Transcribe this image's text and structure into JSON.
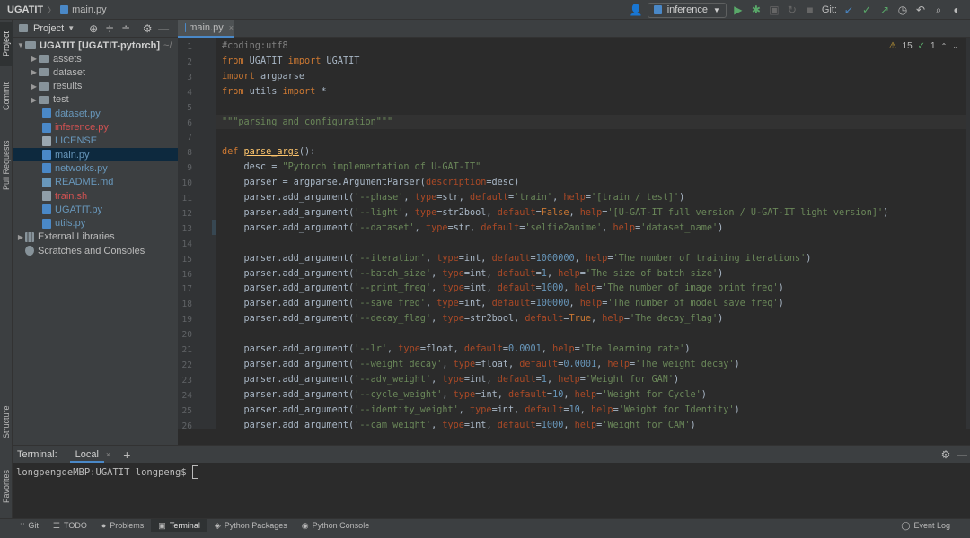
{
  "breadcrumb": {
    "project": "UGATIT",
    "file": "main.py"
  },
  "toolbar": {
    "run_config": "inference",
    "git_label": "Git:"
  },
  "left_strip": {
    "project": "Project",
    "commit": "Commit",
    "pull_requests": "Pull Requests",
    "structure": "Structure",
    "favorites": "Favorites"
  },
  "project_panel": {
    "title": "Project",
    "root": "UGATIT [UGATIT-pytorch]",
    "root_path": "~/",
    "items": [
      {
        "label": "assets",
        "kind": "folder",
        "color": "#bbbbbb"
      },
      {
        "label": "dataset",
        "kind": "folder",
        "color": "#bbbbbb"
      },
      {
        "label": "results",
        "kind": "folder",
        "color": "#bbbbbb"
      },
      {
        "label": "test",
        "kind": "folder",
        "color": "#bbbbbb"
      },
      {
        "label": "dataset.py",
        "kind": "py",
        "color": "#6897bb"
      },
      {
        "label": "inference.py",
        "kind": "py",
        "color": "#d25252"
      },
      {
        "label": "LICENSE",
        "kind": "txt",
        "color": "#6897bb"
      },
      {
        "label": "main.py",
        "kind": "py",
        "color": "#6897bb"
      },
      {
        "label": "networks.py",
        "kind": "py",
        "color": "#6897bb"
      },
      {
        "label": "README.md",
        "kind": "md",
        "color": "#6897bb"
      },
      {
        "label": "train.sh",
        "kind": "sh",
        "color": "#d25252"
      },
      {
        "label": "UGATIT.py",
        "kind": "py",
        "color": "#6897bb"
      },
      {
        "label": "utils.py",
        "kind": "py",
        "color": "#6897bb"
      },
      {
        "label": "External Libraries",
        "kind": "lib",
        "color": "#bbbbbb"
      },
      {
        "label": "Scratches and Consoles",
        "kind": "scratch",
        "color": "#bbbbbb"
      }
    ]
  },
  "editor": {
    "tab": "main.py",
    "warnings": "15",
    "checks": "1",
    "lines": [
      {
        "n": "1",
        "t": [
          [
            "cmt",
            "#coding:utf8"
          ]
        ]
      },
      {
        "n": "2",
        "t": [
          [
            "kw",
            "from "
          ],
          [
            "",
            "UGATIT "
          ],
          [
            "kw",
            "import "
          ],
          [
            "",
            "UGATIT"
          ]
        ]
      },
      {
        "n": "3",
        "t": [
          [
            "kw",
            "import "
          ],
          [
            "",
            "argparse"
          ]
        ]
      },
      {
        "n": "4",
        "t": [
          [
            "kw",
            "from "
          ],
          [
            "",
            "utils "
          ],
          [
            "kw",
            "import "
          ],
          [
            "",
            "*"
          ]
        ]
      },
      {
        "n": "5",
        "t": []
      },
      {
        "n": "6",
        "t": [
          [
            "str",
            "\"\"\"parsing and configuration\"\"\""
          ]
        ]
      },
      {
        "n": "7",
        "t": []
      },
      {
        "n": "8",
        "t": [
          [
            "kw",
            "def "
          ],
          [
            "fn",
            "parse_args"
          ],
          [
            "",
            "():"
          ]
        ]
      },
      {
        "n": "9",
        "t": [
          [
            "",
            "    desc = "
          ],
          [
            "str",
            "\"Pytorch implementation of U-GAT-IT\""
          ]
        ]
      },
      {
        "n": "10",
        "t": [
          [
            "",
            "    parser = argparse.ArgumentParser("
          ],
          [
            "prm",
            "description"
          ],
          [
            "",
            "=desc)"
          ]
        ]
      },
      {
        "n": "11",
        "t": [
          [
            "",
            "    parser.add_argument("
          ],
          [
            "str",
            "'--phase'"
          ],
          [
            "",
            ", "
          ],
          [
            "prm",
            "type"
          ],
          [
            "",
            "=str, "
          ],
          [
            "prm",
            "default"
          ],
          [
            "",
            "="
          ],
          [
            "str",
            "'train'"
          ],
          [
            "",
            ", "
          ],
          [
            "prm",
            "help"
          ],
          [
            "",
            "="
          ],
          [
            "str",
            "'[train / test]'"
          ],
          [
            "",
            ")"
          ]
        ]
      },
      {
        "n": "12",
        "t": [
          [
            "",
            "    parser.add_argument("
          ],
          [
            "str",
            "'--light'"
          ],
          [
            "",
            ", "
          ],
          [
            "prm",
            "type"
          ],
          [
            "",
            "=str2bool, "
          ],
          [
            "prm",
            "default"
          ],
          [
            "",
            "="
          ],
          [
            "kw",
            "False"
          ],
          [
            "",
            ", "
          ],
          [
            "prm",
            "help"
          ],
          [
            "",
            "="
          ],
          [
            "str",
            "'[U-GAT-IT full version / U-GAT-IT light version]'"
          ],
          [
            "",
            ")"
          ]
        ]
      },
      {
        "n": "13",
        "t": [
          [
            "",
            "    parser.add_argument("
          ],
          [
            "str",
            "'--dataset'"
          ],
          [
            "",
            ", "
          ],
          [
            "prm",
            "type"
          ],
          [
            "",
            "=str, "
          ],
          [
            "prm",
            "default"
          ],
          [
            "",
            "="
          ],
          [
            "str",
            "'selfie2anime'"
          ],
          [
            "",
            ", "
          ],
          [
            "prm",
            "help"
          ],
          [
            "",
            "="
          ],
          [
            "str",
            "'dataset_name'"
          ],
          [
            "",
            ")"
          ]
        ]
      },
      {
        "n": "14",
        "t": []
      },
      {
        "n": "15",
        "t": [
          [
            "",
            "    parser.add_argument("
          ],
          [
            "str",
            "'--iteration'"
          ],
          [
            "",
            ", "
          ],
          [
            "prm",
            "type"
          ],
          [
            "",
            "=int, "
          ],
          [
            "prm",
            "default"
          ],
          [
            "",
            "="
          ],
          [
            "num",
            "1000000"
          ],
          [
            "",
            ", "
          ],
          [
            "prm",
            "help"
          ],
          [
            "",
            "="
          ],
          [
            "str",
            "'The number of training iterations'"
          ],
          [
            "",
            ")"
          ]
        ]
      },
      {
        "n": "16",
        "t": [
          [
            "",
            "    parser.add_argument("
          ],
          [
            "str",
            "'--batch_size'"
          ],
          [
            "",
            ", "
          ],
          [
            "prm",
            "type"
          ],
          [
            "",
            "=int, "
          ],
          [
            "prm",
            "default"
          ],
          [
            "",
            "="
          ],
          [
            "num",
            "1"
          ],
          [
            "",
            ", "
          ],
          [
            "prm",
            "help"
          ],
          [
            "",
            "="
          ],
          [
            "str",
            "'The size of batch size'"
          ],
          [
            "",
            ")"
          ]
        ]
      },
      {
        "n": "17",
        "t": [
          [
            "",
            "    parser.add_argument("
          ],
          [
            "str",
            "'--print_freq'"
          ],
          [
            "",
            ", "
          ],
          [
            "prm",
            "type"
          ],
          [
            "",
            "=int, "
          ],
          [
            "prm",
            "default"
          ],
          [
            "",
            "="
          ],
          [
            "num",
            "1000"
          ],
          [
            "",
            ", "
          ],
          [
            "prm",
            "help"
          ],
          [
            "",
            "="
          ],
          [
            "str",
            "'The number of image print freq'"
          ],
          [
            "",
            ")"
          ]
        ]
      },
      {
        "n": "18",
        "t": [
          [
            "",
            "    parser.add_argument("
          ],
          [
            "str",
            "'--save_freq'"
          ],
          [
            "",
            ", "
          ],
          [
            "prm",
            "type"
          ],
          [
            "",
            "=int, "
          ],
          [
            "prm",
            "default"
          ],
          [
            "",
            "="
          ],
          [
            "num",
            "100000"
          ],
          [
            "",
            ", "
          ],
          [
            "prm",
            "help"
          ],
          [
            "",
            "="
          ],
          [
            "str",
            "'The number of model save freq'"
          ],
          [
            "",
            ")"
          ]
        ]
      },
      {
        "n": "19",
        "t": [
          [
            "",
            "    parser.add_argument("
          ],
          [
            "str",
            "'--decay_flag'"
          ],
          [
            "",
            ", "
          ],
          [
            "prm",
            "type"
          ],
          [
            "",
            "=str2bool, "
          ],
          [
            "prm",
            "default"
          ],
          [
            "",
            "="
          ],
          [
            "kw",
            "True"
          ],
          [
            "",
            ", "
          ],
          [
            "prm",
            "help"
          ],
          [
            "",
            "="
          ],
          [
            "str",
            "'The decay_flag'"
          ],
          [
            "",
            ")"
          ]
        ]
      },
      {
        "n": "20",
        "t": []
      },
      {
        "n": "21",
        "t": [
          [
            "",
            "    parser.add_argument("
          ],
          [
            "str",
            "'--lr'"
          ],
          [
            "",
            ", "
          ],
          [
            "prm",
            "type"
          ],
          [
            "",
            "=float, "
          ],
          [
            "prm",
            "default"
          ],
          [
            "",
            "="
          ],
          [
            "num",
            "0.0001"
          ],
          [
            "",
            ", "
          ],
          [
            "prm",
            "help"
          ],
          [
            "",
            "="
          ],
          [
            "str",
            "'The learning rate'"
          ],
          [
            "",
            ")"
          ]
        ]
      },
      {
        "n": "22",
        "t": [
          [
            "",
            "    parser.add_argument("
          ],
          [
            "str",
            "'--weight_decay'"
          ],
          [
            "",
            ", "
          ],
          [
            "prm",
            "type"
          ],
          [
            "",
            "=float, "
          ],
          [
            "prm",
            "default"
          ],
          [
            "",
            "="
          ],
          [
            "num",
            "0.0001"
          ],
          [
            "",
            ", "
          ],
          [
            "prm",
            "help"
          ],
          [
            "",
            "="
          ],
          [
            "str",
            "'The weight decay'"
          ],
          [
            "",
            ")"
          ]
        ]
      },
      {
        "n": "23",
        "t": [
          [
            "",
            "    parser.add_argument("
          ],
          [
            "str",
            "'--adv_weight'"
          ],
          [
            "",
            ", "
          ],
          [
            "prm",
            "type"
          ],
          [
            "",
            "=int, "
          ],
          [
            "prm",
            "default"
          ],
          [
            "",
            "="
          ],
          [
            "num",
            "1"
          ],
          [
            "",
            ", "
          ],
          [
            "prm",
            "help"
          ],
          [
            "",
            "="
          ],
          [
            "str",
            "'Weight for GAN'"
          ],
          [
            "",
            ")"
          ]
        ]
      },
      {
        "n": "24",
        "t": [
          [
            "",
            "    parser.add_argument("
          ],
          [
            "str",
            "'--cycle_weight'"
          ],
          [
            "",
            ", "
          ],
          [
            "prm",
            "type"
          ],
          [
            "",
            "=int, "
          ],
          [
            "prm",
            "default"
          ],
          [
            "",
            "="
          ],
          [
            "num",
            "10"
          ],
          [
            "",
            ", "
          ],
          [
            "prm",
            "help"
          ],
          [
            "",
            "="
          ],
          [
            "str",
            "'Weight for Cycle'"
          ],
          [
            "",
            ")"
          ]
        ]
      },
      {
        "n": "25",
        "t": [
          [
            "",
            "    parser.add_argument("
          ],
          [
            "str",
            "'--identity_weight'"
          ],
          [
            "",
            ", "
          ],
          [
            "prm",
            "type"
          ],
          [
            "",
            "=int, "
          ],
          [
            "prm",
            "default"
          ],
          [
            "",
            "="
          ],
          [
            "num",
            "10"
          ],
          [
            "",
            ", "
          ],
          [
            "prm",
            "help"
          ],
          [
            "",
            "="
          ],
          [
            "str",
            "'Weight for Identity'"
          ],
          [
            "",
            ")"
          ]
        ]
      },
      {
        "n": "26",
        "t": [
          [
            "",
            "    parser.add_argument("
          ],
          [
            "str",
            "'--cam_weight'"
          ],
          [
            "",
            ", "
          ],
          [
            "prm",
            "type"
          ],
          [
            "",
            "=int, "
          ],
          [
            "prm",
            "default"
          ],
          [
            "",
            "="
          ],
          [
            "num",
            "1000"
          ],
          [
            "",
            ", "
          ],
          [
            "prm",
            "help"
          ],
          [
            "",
            "="
          ],
          [
            "str",
            "'Weight for CAM'"
          ],
          [
            "",
            ")"
          ]
        ]
      }
    ]
  },
  "terminal": {
    "label": "Terminal:",
    "tab": "Local",
    "prompt": "longpengdeMBP:UGATIT longpeng$"
  },
  "bottom_tools": [
    {
      "label": "Git",
      "icon": "git-icon"
    },
    {
      "label": "TODO",
      "icon": "todo-icon"
    },
    {
      "label": "Problems",
      "icon": "problems-icon"
    },
    {
      "label": "Terminal",
      "icon": "terminal-icon"
    },
    {
      "label": "Python Packages",
      "icon": "packages-icon"
    },
    {
      "label": "Python Console",
      "icon": "console-icon"
    }
  ],
  "event_log": "Event Log"
}
